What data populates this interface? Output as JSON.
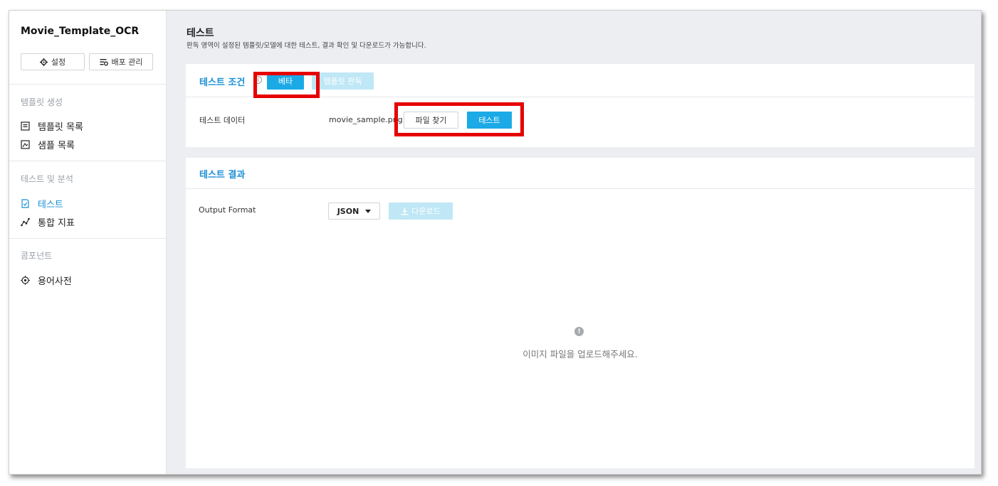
{
  "app": {
    "title": "Movie_Template_OCR"
  },
  "sidebar": {
    "buttons": {
      "settings": "설정",
      "deploy": "배포 관리"
    },
    "sections": [
      {
        "label": "템플릿 생성",
        "items": [
          {
            "label": "템플릿 목록",
            "icon": "list-icon"
          },
          {
            "label": "샘플 목록",
            "icon": "image-icon"
          }
        ]
      },
      {
        "label": "테스트 및 분석",
        "items": [
          {
            "label": "테스트",
            "icon": "check-document-icon",
            "active": true
          },
          {
            "label": "통합 지표",
            "icon": "graph-icon"
          }
        ]
      },
      {
        "label": "콤포넌트",
        "items": [
          {
            "label": "용어사전",
            "icon": "target-icon"
          }
        ]
      }
    ]
  },
  "page": {
    "title": "테스트",
    "description": "판독 영역이 설정된 템플릿/모델에 대한 테스트, 결과 확인 및 다운로드가 가능합니다."
  },
  "test_condition": {
    "title": "테스트 조건",
    "info_icon": "i",
    "beta_button": "베타",
    "template_read_button": "템플릿 판독",
    "data_label": "테스트 데이터",
    "file_name": "movie_sample.png",
    "find_file_button": "파일 찾기",
    "test_button": "테스트"
  },
  "test_result": {
    "title": "테스트 결과",
    "output_format_label": "Output Format",
    "format_selected": "JSON",
    "download_button": "다운로드",
    "empty_icon": "!",
    "empty_message": "이미지 파일을 업로드해주세요."
  },
  "colors": {
    "accent": "#1baae6",
    "accent_text": "#1a8fd6",
    "disabled": "#bfe7f6",
    "highlight": "#e60000"
  }
}
